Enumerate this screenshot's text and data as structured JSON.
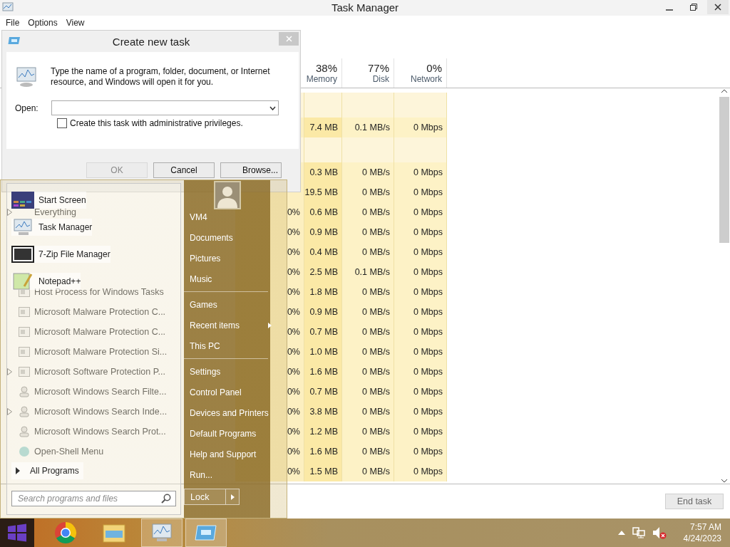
{
  "task_manager": {
    "title": "Task Manager",
    "menu": [
      "File",
      "Options",
      "View"
    ],
    "columns": [
      {
        "percent": "38%",
        "label": "Memory"
      },
      {
        "percent": "77%",
        "label": "Disk"
      },
      {
        "percent": "0%",
        "label": "Network"
      }
    ],
    "rows": [
      {
        "kind": "group"
      },
      {
        "kind": "process",
        "memory": "7.4 MB",
        "disk": "0.1 MB/s",
        "network": "0 Mbps"
      },
      {
        "kind": "group"
      },
      {
        "kind": "process",
        "memory": "0.3 MB",
        "disk": "0 MB/s",
        "network": "0 Mbps"
      },
      {
        "kind": "process",
        "memory": "19.5 MB",
        "disk": "0 MB/s",
        "network": "0 Mbps"
      },
      {
        "kind": "process",
        "name": "Everything",
        "expandable": true,
        "cpu": "0%",
        "memory": "0.6 MB",
        "disk": "0 MB/s",
        "network": "0 Mbps"
      },
      {
        "kind": "process",
        "cpu": "0%",
        "memory": "0.9 MB",
        "disk": "0 MB/s",
        "network": "0 Mbps"
      },
      {
        "kind": "process",
        "cpu": "0%",
        "memory": "0.4 MB",
        "disk": "0 MB/s",
        "network": "0 Mbps"
      },
      {
        "kind": "process",
        "cpu": "0%",
        "memory": "2.5 MB",
        "disk": "0.1 MB/s",
        "network": "0 Mbps"
      },
      {
        "kind": "service",
        "name": "Host Process for Windows Tasks",
        "expandable": false,
        "cpu": "0%",
        "memory": "1.8 MB",
        "disk": "0 MB/s",
        "network": "0 Mbps"
      },
      {
        "kind": "service",
        "name": "Microsoft Malware Protection C...",
        "expandable": false,
        "cpu": "0%",
        "memory": "0.9 MB",
        "disk": "0 MB/s",
        "network": "0 Mbps"
      },
      {
        "kind": "service",
        "name": "Microsoft Malware Protection C...",
        "expandable": false,
        "cpu": "0%",
        "memory": "0.7 MB",
        "disk": "0 MB/s",
        "network": "0 Mbps"
      },
      {
        "kind": "service",
        "name": "Microsoft Malware Protection Si...",
        "expandable": false,
        "cpu": "0%",
        "memory": "1.0 MB",
        "disk": "0 MB/s",
        "network": "0 Mbps"
      },
      {
        "kind": "service",
        "name": "Microsoft Software Protection P...",
        "expandable": true,
        "cpu": "0%",
        "memory": "1.6 MB",
        "disk": "0 MB/s",
        "network": "0 Mbps"
      },
      {
        "kind": "search",
        "name": "Microsoft Windows Search Filte...",
        "expandable": false,
        "cpu": "0%",
        "memory": "0.7 MB",
        "disk": "0 MB/s",
        "network": "0 Mbps"
      },
      {
        "kind": "search",
        "name": "Microsoft Windows Search Inde...",
        "expandable": true,
        "cpu": "0%",
        "memory": "3.8 MB",
        "disk": "0 MB/s",
        "network": "0 Mbps"
      },
      {
        "kind": "search",
        "name": "Microsoft Windows Search Prot...",
        "expandable": false,
        "cpu": "0%",
        "memory": "1.2 MB",
        "disk": "0 MB/s",
        "network": "0 Mbps"
      },
      {
        "kind": "shell",
        "name": "Open-Shell Menu",
        "expandable": false,
        "cpu": "0%",
        "memory": "1.6 MB",
        "disk": "0 MB/s",
        "network": "0 Mbps"
      },
      {
        "kind": "process",
        "cpu": "0%",
        "memory": "1.5 MB",
        "disk": "0 MB/s",
        "network": "0 Mbps"
      }
    ],
    "end_task": {
      "label": "End task",
      "disabled": true
    }
  },
  "dialog": {
    "title": "Create new task",
    "message": "Type the name of a program, folder, document, or Internet resource, and Windows will open it for you.",
    "open_label": "Open:",
    "checkbox": {
      "label": "Create this task with administrative privileges.",
      "checked": false
    },
    "buttons": [
      {
        "label": "OK",
        "disabled": true
      },
      {
        "label": "Cancel",
        "disabled": false
      },
      {
        "label": "Browse...",
        "disabled": false
      }
    ]
  },
  "start_menu": {
    "programs": [
      {
        "kind": "start",
        "label": "Start Screen"
      },
      {
        "kind": "taskmgr",
        "label": "Task Manager"
      },
      {
        "kind": "zip",
        "label": "7-Zip File Manager"
      },
      {
        "kind": "notepad",
        "label": "Notepad++"
      }
    ],
    "all_programs": "All Programs",
    "search": {
      "placeholder": "Search programs and files"
    },
    "places": [
      {
        "kind": "item",
        "label": "VM4",
        "submenu": false
      },
      {
        "kind": "item",
        "label": "Documents",
        "submenu": false
      },
      {
        "kind": "item",
        "label": "Pictures",
        "submenu": false
      },
      {
        "kind": "item",
        "label": "Music",
        "submenu": false
      },
      {
        "kind": "separator"
      },
      {
        "kind": "item",
        "label": "Games",
        "submenu": false
      },
      {
        "kind": "item",
        "label": "Recent items",
        "submenu": true
      },
      {
        "kind": "item",
        "label": "This PC",
        "submenu": false
      },
      {
        "kind": "separator"
      },
      {
        "kind": "item",
        "label": "Settings",
        "submenu": false
      },
      {
        "kind": "item",
        "label": "Control Panel",
        "submenu": false
      },
      {
        "kind": "item",
        "label": "Devices and Printers",
        "submenu": false
      },
      {
        "kind": "item",
        "label": "Default Programs",
        "submenu": false
      },
      {
        "kind": "item",
        "label": "Help and Support",
        "submenu": false
      },
      {
        "kind": "item",
        "label": "Run...",
        "submenu": false
      }
    ],
    "lock": "Lock"
  },
  "taskbar": {
    "apps": [
      {
        "kind": "start",
        "active": false
      },
      {
        "kind": "chrome",
        "active": false
      },
      {
        "kind": "explorer",
        "active": false
      },
      {
        "kind": "taskmgr",
        "active": true
      },
      {
        "kind": "run",
        "active": true
      }
    ],
    "volume_muted": true,
    "time": "7:57 AM",
    "date": "4/24/2023"
  }
}
